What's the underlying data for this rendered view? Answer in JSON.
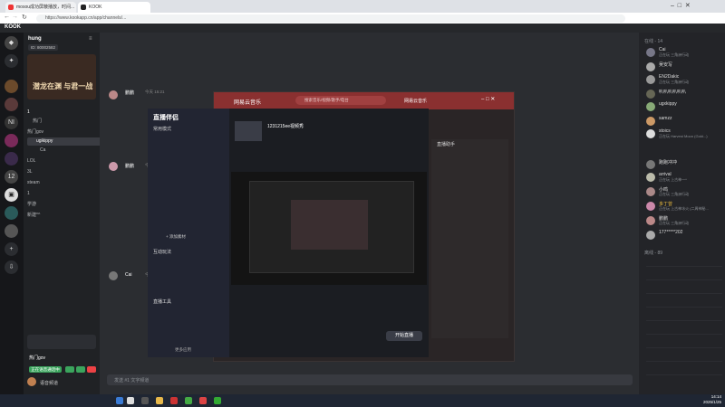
{
  "browser": {
    "tabs": [
      {
        "label": "mosou成功屏蔽播放，时间..."
      },
      {
        "label": "KOOK"
      }
    ],
    "url": "https://www.kookapp.cn/app/channels/..."
  },
  "app": {
    "brand": "KOOK"
  },
  "server": {
    "name": "hung",
    "id_badge": "ID: 80002582",
    "banner": "潜龙在渊 与君一战",
    "channels": [
      {
        "label": "1"
      },
      {
        "label": "热门"
      },
      {
        "label": "热门gov"
      },
      {
        "label": "ugikippy"
      },
      {
        "label": "Ca"
      },
      {
        "label": "LOL"
      },
      {
        "label": "3L"
      },
      {
        "label": "steam"
      },
      {
        "label": "1"
      },
      {
        "label": "学游"
      },
      {
        "label": "新建*^"
      }
    ],
    "voice_status": "正在语音通话中",
    "user_label": "热门gov",
    "footer_label": "语音频道"
  },
  "chat": {
    "messages": [
      {
        "author": "鹏鹏",
        "time": "今天 15:21"
      },
      {
        "author": "鹏鹏",
        "time": "今天 15:22"
      },
      {
        "author": "Cai",
        "time": "今天 15:24"
      }
    ],
    "input_placeholder": "发送 #1 文字频道"
  },
  "members": {
    "header": "在线 - 14",
    "online": [
      {
        "name": "Cai",
        "status": "正在玩 三角洲行动"
      },
      {
        "name": "吴安写"
      },
      {
        "name": "EN2Dakic",
        "status": "正在玩 三角洲行动"
      },
      {
        "name": "叭叭叭叭叭叭"
      },
      {
        "name": "ugxkippy"
      },
      {
        "name": "samzz"
      },
      {
        "name": "stoics",
        "status": "正在玩 Harvest Moon (Gold...)"
      },
      {
        "name": "跑跑冲冲"
      },
      {
        "name": "arrival",
        "status": "正在玩 上古神一^"
      },
      {
        "name": "小鸣",
        "status": "正在玩 三角洲行动"
      },
      {
        "name": "多丁曾",
        "status": "正在玩 上古神冰火 (二周神秘..."
      },
      {
        "name": "鹏鹏",
        "status": "正在玩 三角洲行动"
      },
      {
        "name": "177*****202"
      }
    ],
    "offline_header": "离线 - 89"
  },
  "music": {
    "title": "网易云音乐",
    "search_placeholder": "搜索音乐/视频/歌手/电台",
    "user": "网易云音乐"
  },
  "live": {
    "title": "直播伴侣",
    "scene": "常用模式",
    "add_scene": "+ 添加素材",
    "stream_title": "1231215ee视频秀",
    "tools": [
      {
        "label": "互动玩法"
      },
      {
        "label": "直播工具"
      },
      {
        "label": "更多应用"
      }
    ],
    "start_button": "开始直播",
    "side_title": "直播助手"
  },
  "taskbar": {
    "time": "14:14",
    "date": "2025/1/25"
  }
}
